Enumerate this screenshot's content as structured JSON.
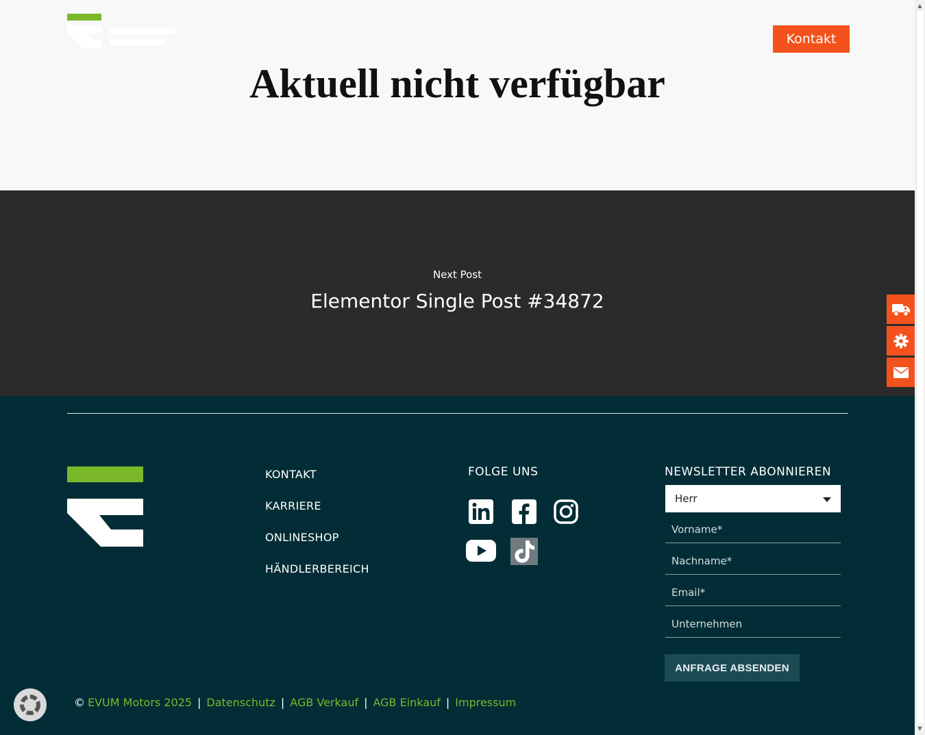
{
  "header": {
    "contact_label": "Kontakt",
    "page_title": "Aktuell nicht verfügbar"
  },
  "next_post": {
    "label": "Next Post",
    "title": "Elementor Single Post #34872"
  },
  "side_buttons": [
    "truck-icon",
    "gear-icon",
    "envelope-icon"
  ],
  "footer": {
    "nav": [
      "KONTAKT",
      "KARRIERE",
      "ONLINESHOP",
      "HÄNDLERBEREICH"
    ],
    "follow_heading": "FOLGE UNS",
    "social": [
      "linkedin-icon",
      "facebook-icon",
      "instagram-icon",
      "youtube-icon",
      "tiktok-icon"
    ],
    "newsletter": {
      "heading": "NEWSLETTER ABONNIEREN",
      "salutation": "Herr",
      "first_name_placeholder": "Vorname*",
      "last_name_placeholder": "Nachname*",
      "email_placeholder": "Email*",
      "company_placeholder": "Unternehmen",
      "submit_label": "ANFRAGE ABSENDEN"
    },
    "bottom": {
      "copyright_symbol": "©",
      "copyright": "EVUM Motors 2025",
      "links": [
        "Datenschutz",
        "AGB Verkauf",
        "AGB Einkauf",
        "Impressum"
      ],
      "separator": "|"
    }
  },
  "colors": {
    "accent": "#f4521c",
    "brand_green": "#7ab82a",
    "footer_bg": "#022d36",
    "next_post_bg": "#2b2b2b"
  }
}
